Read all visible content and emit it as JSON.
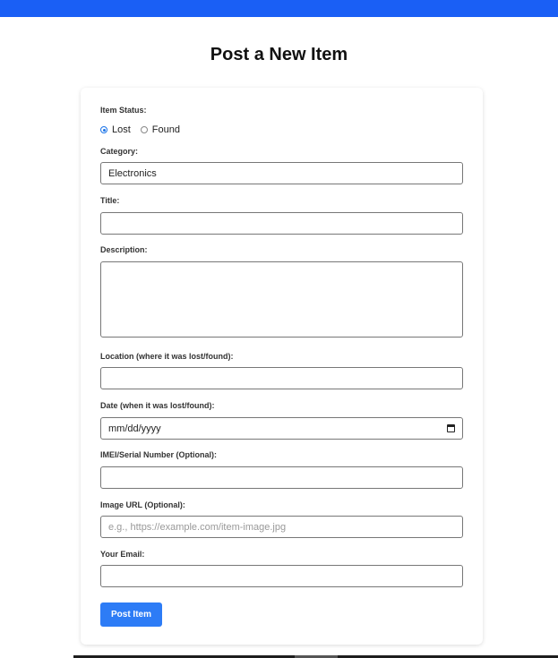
{
  "page": {
    "title": "Post a New Item"
  },
  "colors": {
    "accent": "#1a5ff5",
    "button": "#2d7cf6"
  },
  "form": {
    "status": {
      "label": "Item Status:",
      "options": [
        "Lost",
        "Found"
      ],
      "selected": "Lost"
    },
    "category": {
      "label": "Category:",
      "value": "Electronics"
    },
    "title": {
      "label": "Title:",
      "value": ""
    },
    "description": {
      "label": "Description:",
      "value": ""
    },
    "location": {
      "label": "Location (where it was lost/found):",
      "value": ""
    },
    "date": {
      "label": "Date (when it was lost/found):",
      "value": "mm/dd/yyyy",
      "icon": "calendar-icon"
    },
    "imei": {
      "label": "IMEI/Serial Number (Optional):",
      "value": ""
    },
    "image_url": {
      "label": "Image URL (Optional):",
      "placeholder": "e.g., https://example.com/item-image.jpg"
    },
    "email": {
      "label": "Your Email:",
      "value": ""
    },
    "submit_label": "Post Item"
  }
}
